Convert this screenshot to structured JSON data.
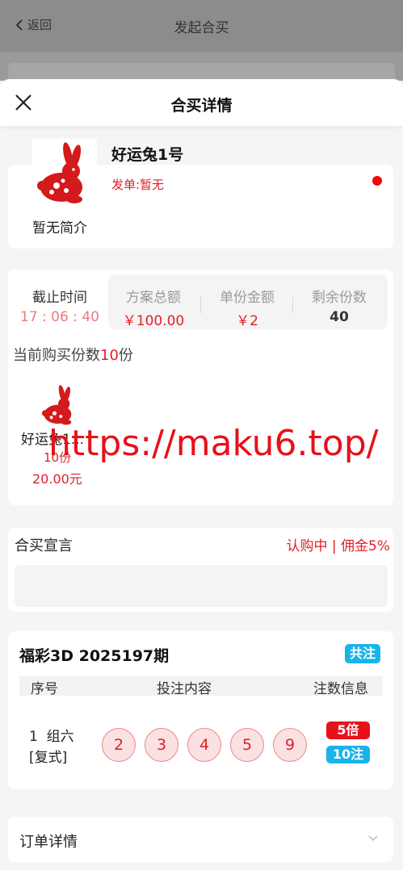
{
  "background": {
    "back_label": "返回",
    "title": "发起合买"
  },
  "sheet": {
    "title": "合买详情"
  },
  "plan": {
    "name": "好运兔1号",
    "issuer": "发单:暂无",
    "intro": "暂无简介"
  },
  "stats": {
    "deadline_label": "截止时间",
    "deadline_value": "17 : 06 : 40",
    "total_label": "方案总额",
    "total_value": "￥100.00",
    "unit_label": "单份金额",
    "unit_value": "￥2",
    "remaining_label": "剩余份数",
    "remaining_value": "40"
  },
  "purchase": {
    "prefix": "当前购买份数",
    "count": "10",
    "suffix": "份",
    "item_name": "好运兔1...",
    "item_copies": "10份",
    "item_amount": "20.00元"
  },
  "watermark": "https://maku6.top/",
  "declaration": {
    "title": "合买宣言",
    "status": "认购中 | 佣金5%"
  },
  "bet": {
    "title": "福彩3D 2025197期",
    "badge": "共注",
    "headers": [
      "序号",
      "投注内容",
      "注数信息"
    ],
    "row": {
      "index": "1",
      "type": "组六",
      "mode": "[复式]",
      "balls": [
        "2",
        "3",
        "4",
        "5",
        "9"
      ],
      "multiple": "5倍",
      "notes": "10注"
    }
  },
  "order": {
    "title": "订单详情"
  },
  "colors": {
    "accent_red": "#e0202a",
    "accent_cyan": "#1ab3ea"
  },
  "icons": [
    "chevron-left-icon",
    "close-icon",
    "rabbit-logo",
    "chevron-down-icon"
  ]
}
